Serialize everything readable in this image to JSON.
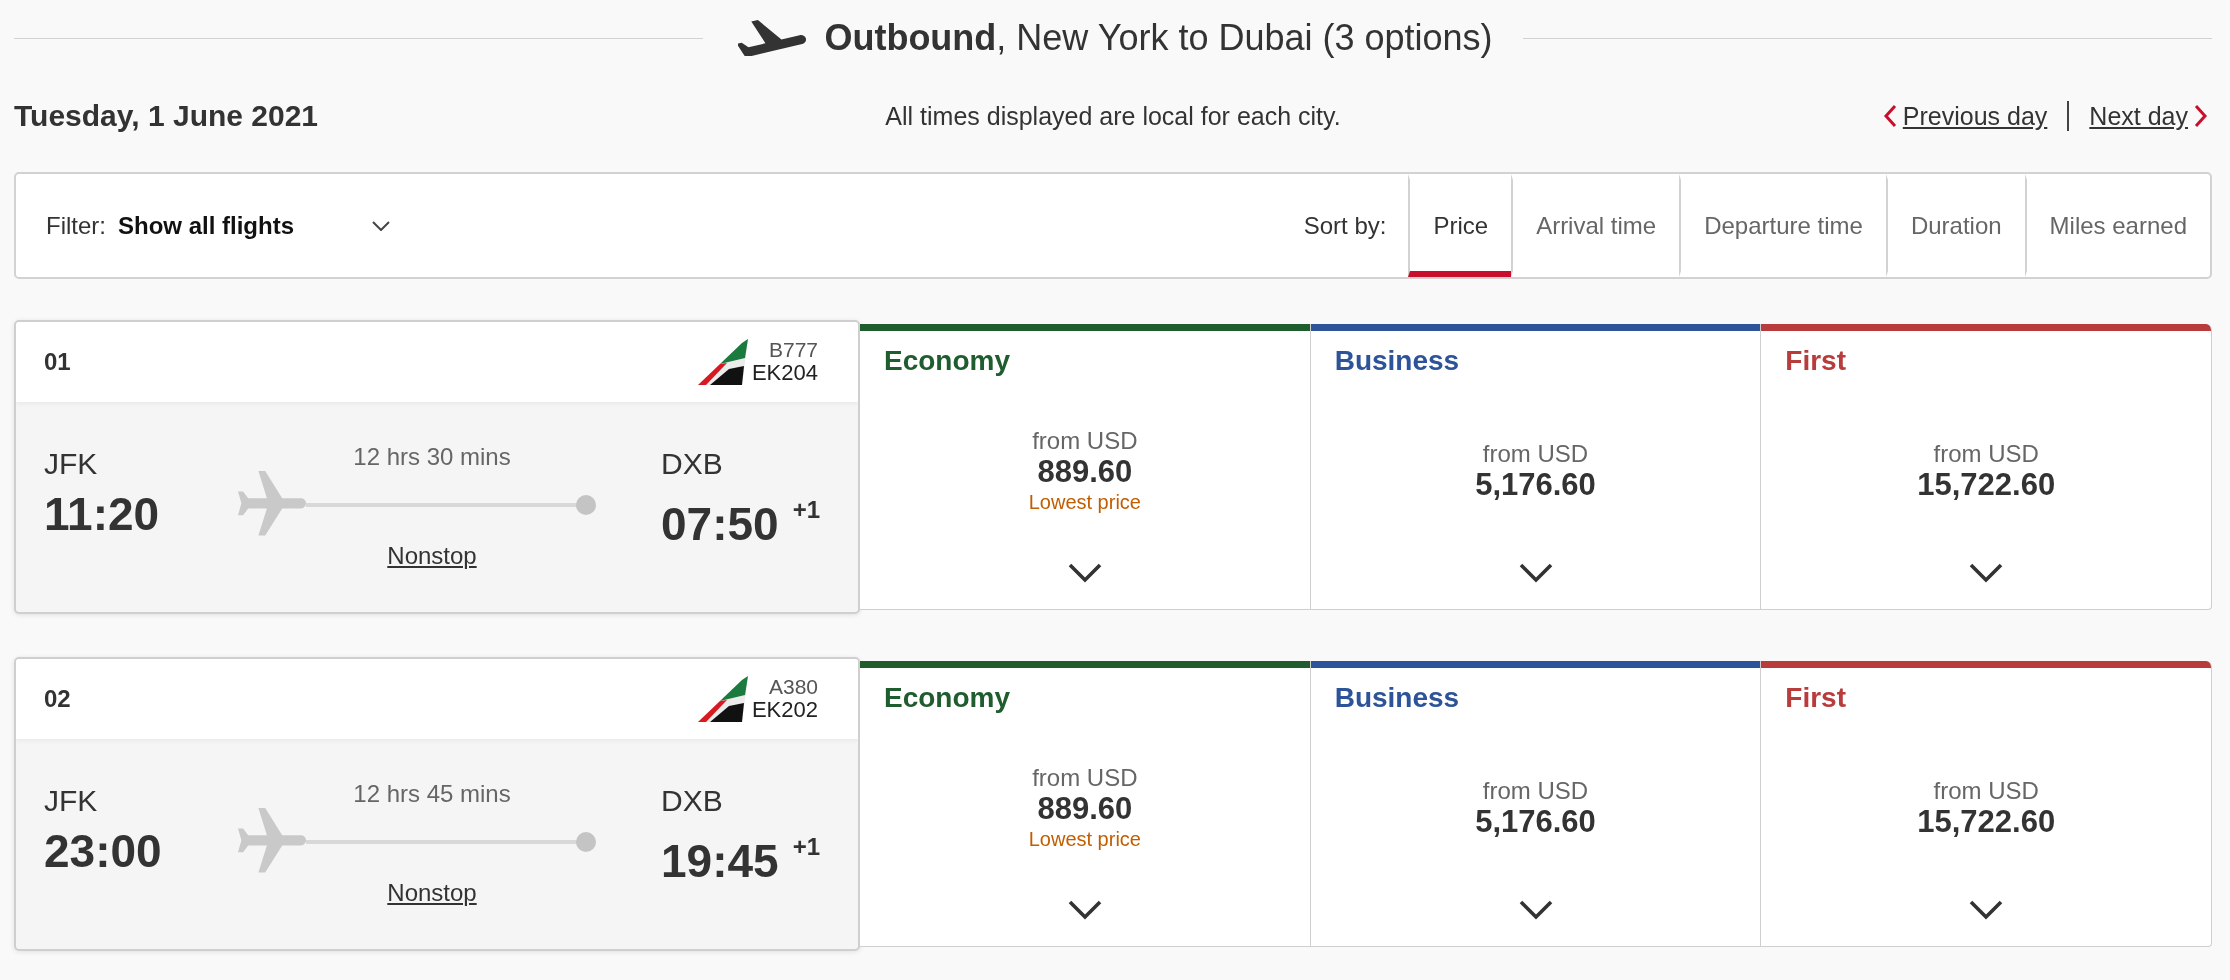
{
  "header": {
    "title": "**Outbound**, New York to Dubai (3 options)"
  },
  "date": "Tuesday, 1 June 2021",
  "note": "All times displayed are local for each city.",
  "day_nav": [
    {
      "label": "Previous day",
      "kind": "prev"
    },
    {
      "label": "Next day",
      "kind": "next"
    }
  ],
  "filter": {
    "label": "Filter:",
    "value": "Show all flights"
  },
  "sort": {
    "label": "Sort by:",
    "tabs": [
      {
        "label": "Price",
        "selected": true
      },
      {
        "label": "Arrival time",
        "selected": false
      },
      {
        "label": "Departure time",
        "selected": false
      },
      {
        "label": "Duration",
        "selected": false
      },
      {
        "label": "Miles earned",
        "selected": false
      }
    ]
  },
  "flights": [
    {
      "number": "01",
      "aircraft": "B777",
      "flight": "EK204",
      "origin": "JFK",
      "departure": "11:20",
      "duration": "12 hrs 30 mins",
      "stops": "Nonstop",
      "destination": "DXB",
      "arrival": "07:50",
      "day_offset": "+1",
      "fares": [
        {
          "cabin": "Economy",
          "color": "#1f5c2e",
          "from": "from USD",
          "price": "889.60",
          "note": "Lowest price"
        },
        {
          "cabin": "Business",
          "color": "#2d5499",
          "from": "from USD",
          "price": "5,176.60"
        },
        {
          "cabin": "First",
          "color": "#b83c3c",
          "from": "from USD",
          "price": "15,722.60"
        }
      ]
    },
    {
      "number": "02",
      "aircraft": "A380",
      "flight": "EK202",
      "origin": "JFK",
      "departure": "23:00",
      "duration": "12 hrs 45 mins",
      "stops": "Nonstop",
      "destination": "DXB",
      "arrival": "19:45",
      "day_offset": "+1",
      "fares": [
        {
          "cabin": "Economy",
          "color": "#1f5c2e",
          "from": "from USD",
          "price": "889.60",
          "note": "Lowest price"
        },
        {
          "cabin": "Business",
          "color": "#2d5499",
          "from": "from USD",
          "price": "5,176.60"
        },
        {
          "cabin": "First",
          "color": "#b83c3c",
          "from": "from USD",
          "price": "15,722.60"
        }
      ]
    }
  ]
}
